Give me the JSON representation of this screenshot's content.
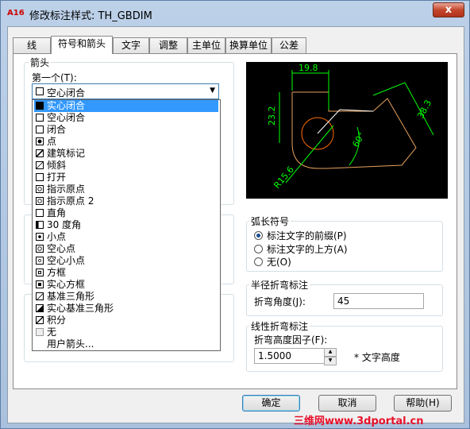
{
  "window": {
    "title": "修改标注样式: TH_GBDIM",
    "app_icon": "A16",
    "close_label": "x"
  },
  "tabs": [
    {
      "label": "线",
      "active": false
    },
    {
      "label": "符号和箭头",
      "active": true
    },
    {
      "label": "文字",
      "active": false
    },
    {
      "label": "调整",
      "active": false
    },
    {
      "label": "主单位",
      "active": false
    },
    {
      "label": "换算单位",
      "active": false
    },
    {
      "label": "公差",
      "active": false
    }
  ],
  "arrowheads": {
    "group_label": "箭头",
    "first_label": "第一个(T):",
    "first_value": "空心闭合",
    "options": [
      {
        "label": "实心闭合",
        "icon": "solid-closed-arrow-icon",
        "selected": true
      },
      {
        "label": "空心闭合",
        "icon": "closed-blank-arrow-icon",
        "selected": false
      },
      {
        "label": "闭合",
        "icon": "closed-arrow-icon",
        "selected": false
      },
      {
        "label": "点",
        "icon": "dot-icon",
        "selected": false
      },
      {
        "label": "建筑标记",
        "icon": "architectural-tick-icon",
        "selected": false
      },
      {
        "label": "倾斜",
        "icon": "oblique-icon",
        "selected": false
      },
      {
        "label": "打开",
        "icon": "open-arrow-icon",
        "selected": false
      },
      {
        "label": "指示原点",
        "icon": "origin-indicator-icon",
        "selected": false
      },
      {
        "label": "指示原点 2",
        "icon": "origin-indicator-2-icon",
        "selected": false
      },
      {
        "label": "直角",
        "icon": "right-angle-icon",
        "selected": false
      },
      {
        "label": "30 度角",
        "icon": "open-30-icon",
        "selected": false
      },
      {
        "label": "小点",
        "icon": "small-dot-icon",
        "selected": false
      },
      {
        "label": "空心点",
        "icon": "dot-blank-icon",
        "selected": false
      },
      {
        "label": "空心小点",
        "icon": "dot-small-blank-icon",
        "selected": false
      },
      {
        "label": "方框",
        "icon": "box-icon",
        "selected": false
      },
      {
        "label": "实心方框",
        "icon": "box-filled-icon",
        "selected": false
      },
      {
        "label": "基准三角形",
        "icon": "datum-triangle-icon",
        "selected": false
      },
      {
        "label": "实心基准三角形",
        "icon": "datum-triangle-filled-icon",
        "selected": false
      },
      {
        "label": "积分",
        "icon": "integral-icon",
        "selected": false
      },
      {
        "label": "无",
        "icon": "none-icon",
        "selected": false
      },
      {
        "label": "用户箭头...",
        "icon": "",
        "selected": false
      }
    ]
  },
  "preview": {
    "dims": [
      "19.8",
      "23.2",
      "38.3",
      "60°",
      "R15.6"
    ],
    "colors": {
      "background": "#000000",
      "dimension": "#00ff00",
      "geometry": "#ff9900",
      "line": "#ffffff",
      "circle": "#ff6600"
    }
  },
  "arc_length": {
    "group_label": "弧长符号",
    "options": [
      {
        "label": "标注文字的前缀(P)",
        "checked": true
      },
      {
        "label": "标注文字的上方(A)",
        "checked": false
      },
      {
        "label": "无(O)",
        "checked": false
      }
    ]
  },
  "radius_jog": {
    "group_label": "半径折弯标注",
    "angle_label": "折弯角度(J):",
    "angle_value": "45"
  },
  "linear_jog": {
    "group_label": "线性折弯标注",
    "height_label": "折弯高度因子(F):",
    "height_value": "1.5000",
    "unit_label": "* 文字高度"
  },
  "buttons": {
    "ok": "确定",
    "cancel": "取消",
    "help": "帮助(H)"
  },
  "watermark": "三维网www.3dportal.cn"
}
